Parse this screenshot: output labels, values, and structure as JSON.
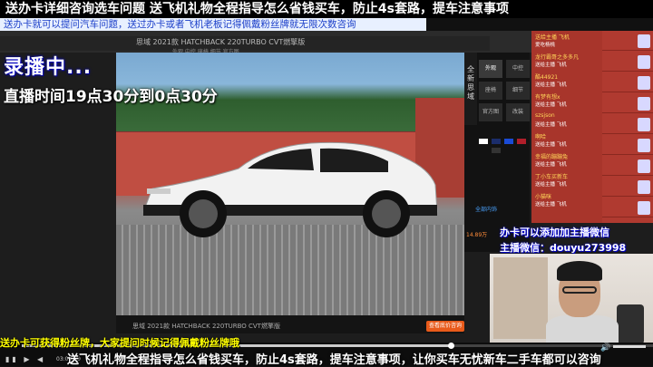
{
  "top_banner": "送办卡详细咨询选车问题  送飞机礼物全程指导怎么省钱买车，防止4s套路，提车注意事项",
  "sub_banner": "送办卡就可以提问汽车问题，送过办卡或者飞机老板记得佩戴粉丝牌就无限次数咨询",
  "live_label": "录播中...",
  "live_time": "直播时间19点30分到0点30分",
  "site": {
    "title": "思域 2021款 HATCHBACK 220TURBO CVT燃擎版",
    "subtitle": "外观 中控 座椅 细节 官方图"
  },
  "car_caption": "思域  2021款 HATCHBACK 220TURBO CVT燃擎版",
  "quote_button": "查看底价咨询",
  "side_tab": "全新思域",
  "options": [
    {
      "label": "外观",
      "active": true
    },
    {
      "label": "中控",
      "active": false
    },
    {
      "label": "座椅",
      "active": false
    },
    {
      "label": "细节",
      "active": false
    },
    {
      "label": "官方图",
      "active": false
    },
    {
      "label": "改装",
      "active": false
    }
  ],
  "price_label": "全部内饰",
  "price_value": "14.89万",
  "swatch_colors": [
    "#ffffff",
    "#1b2d6b",
    "#1a4bd6",
    "#b01e2a",
    "#333333"
  ],
  "gifts": [
    {
      "user": "送给主播 飞机",
      "from": "爱吃杨桃"
    },
    {
      "user": "龙行霸哥之多多凡",
      "from": "送给主播 飞机"
    },
    {
      "user": "酷44921",
      "from": "送给主播 飞机"
    },
    {
      "user": "有梦有想x",
      "from": "送给主播 飞机"
    },
    {
      "user": "szsjson",
      "from": "送给主播 飞机"
    },
    {
      "user": "啊哈",
      "from": "送给主播 飞机"
    },
    {
      "user": "幸福的蹦蹦兔",
      "from": "送给主播 飞机"
    },
    {
      "user": "丁小车买新车",
      "from": "送给主播 飞机"
    },
    {
      "user": "小猫咪",
      "from": "送给主播 飞机"
    }
  ],
  "promo": {
    "line1": "办卡可以添加加主播微信",
    "line2": "主播微信：douyu273998"
  },
  "bottom_banner": "送办卡可获得粉丝牌，大家提问时候记得佩戴粉丝牌哦",
  "bottom_marquee": "送飞机礼物全程指导怎么省钱买车，防止4s套路，提车注意事项，让你买车无忧新车二手车都可以咨询",
  "player": {
    "time": "03:00:09",
    "progress": 0.68,
    "controls": "▮▮ ▶ ◀"
  }
}
